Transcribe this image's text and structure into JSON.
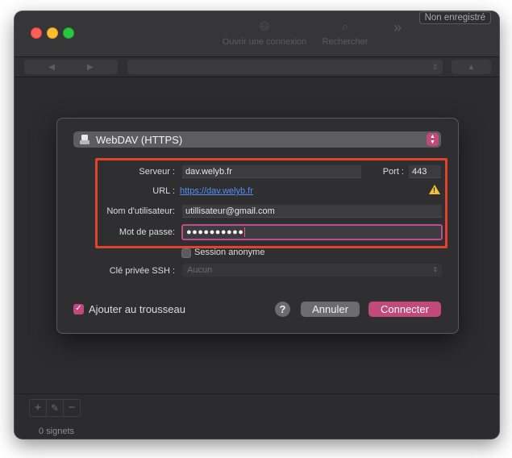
{
  "toolbar": {
    "open_connection": "Ouvrir une connexion",
    "search": "Rechercher",
    "unregistered": "Non enregistré"
  },
  "sheet": {
    "protocol": "WebDAV (HTTPS)",
    "server_label": "Serveur :",
    "server_value": "dav.welyb.fr",
    "port_label": "Port :",
    "port_value": "443",
    "url_label": "URL :",
    "url_value": "https://dav.welyb.fr",
    "username_label": "Nom d'utilisateur:",
    "username_value": "utillisateur@gmail.com",
    "password_label": "Mot de passe:",
    "password_value": "●●●●●●●●●●",
    "anonymous_label": "Session anonyme",
    "ssh_label": "Clé privée SSH :",
    "ssh_value": "Aucun",
    "keychain_label": "Ajouter au trousseau",
    "help": "?",
    "cancel": "Annuler",
    "connect": "Connecter"
  },
  "footer": {
    "bookmarks_count": "0 signets"
  },
  "colors": {
    "accent": "#c2497c",
    "highlight": "#e2432c",
    "link": "#5a8df0"
  }
}
